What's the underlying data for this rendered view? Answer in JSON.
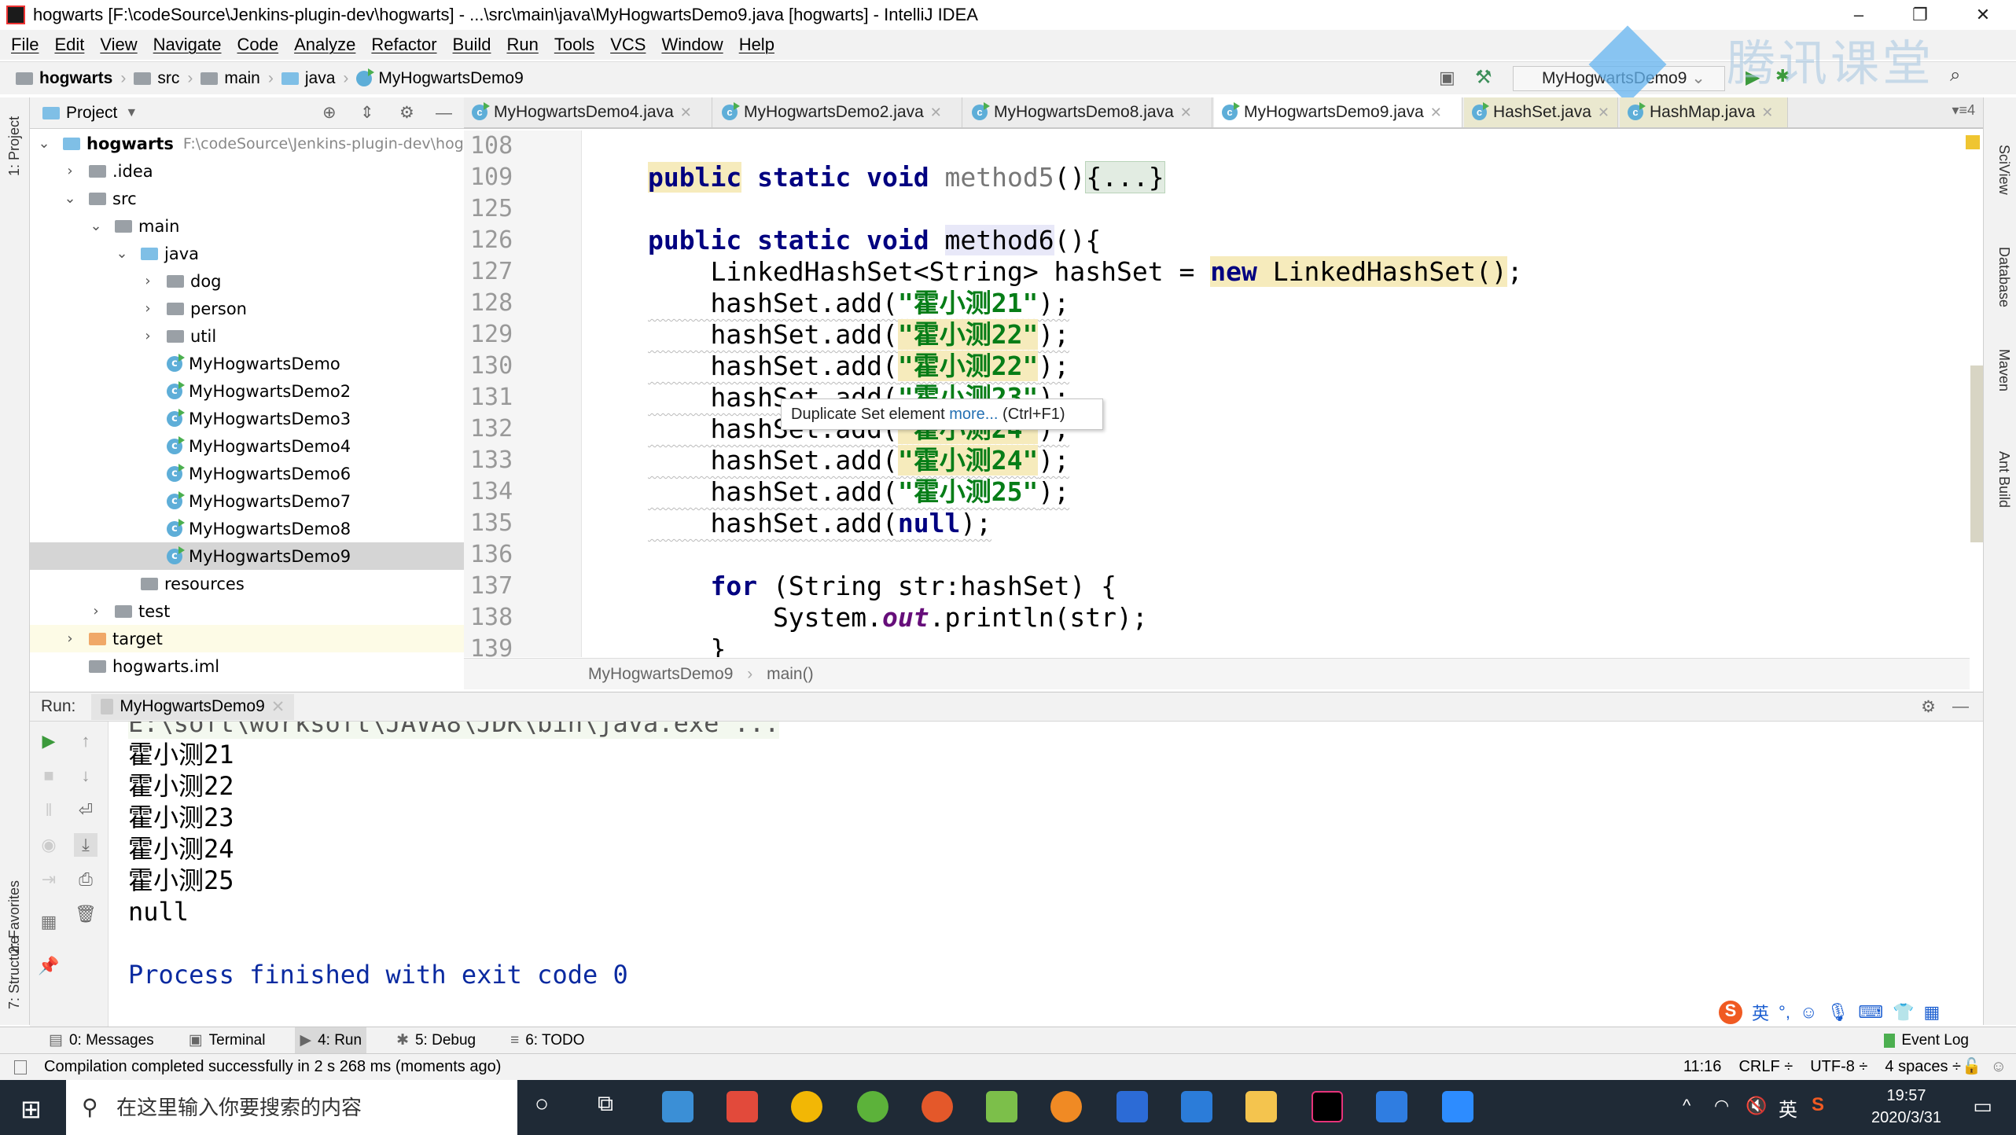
{
  "window": {
    "title": "hogwarts [F:\\codeSource\\Jenkins-plugin-dev\\hogwarts] - ...\\src\\main\\java\\MyHogwartsDemo9.java [hogwarts] - IntelliJ IDEA",
    "minimize": "–",
    "maximize": "❐",
    "close": "✕"
  },
  "menu": [
    "File",
    "Edit",
    "View",
    "Navigate",
    "Code",
    "Analyze",
    "Refactor",
    "Build",
    "Run",
    "Tools",
    "VCS",
    "Window",
    "Help"
  ],
  "breadcrumb": [
    "hogwarts",
    "src",
    "main",
    "java",
    "MyHogwartsDemo9"
  ],
  "run_config": "MyHogwartsDemo9",
  "watermark": "腾讯课堂",
  "left_stripe": {
    "project": "1: Project",
    "favorites": "2: Favorites",
    "structure": "7: Structure"
  },
  "right_stripe": [
    "SciView",
    "Database",
    "Maven",
    "Ant Build"
  ],
  "project": {
    "header": "Project",
    "tree": [
      {
        "label": "hogwarts",
        "path": "F:\\codeSource\\Jenkins-plugin-dev\\hog",
        "depth": 0,
        "arrow": "⌄",
        "icon": "module-folder",
        "bold": true
      },
      {
        "label": ".idea",
        "depth": 1,
        "arrow": "›",
        "icon": "folder"
      },
      {
        "label": "src",
        "depth": 1,
        "arrow": "⌄",
        "icon": "folder"
      },
      {
        "label": "main",
        "depth": 2,
        "arrow": "⌄",
        "icon": "folder"
      },
      {
        "label": "java",
        "depth": 3,
        "arrow": "⌄",
        "icon": "source-folder"
      },
      {
        "label": "dog",
        "depth": 4,
        "arrow": "›",
        "icon": "package"
      },
      {
        "label": "person",
        "depth": 4,
        "arrow": "›",
        "icon": "package"
      },
      {
        "label": "util",
        "depth": 4,
        "arrow": "›",
        "icon": "package"
      },
      {
        "label": "MyHogwartsDemo",
        "depth": 4,
        "arrow": "",
        "icon": "class"
      },
      {
        "label": "MyHogwartsDemo2",
        "depth": 4,
        "arrow": "",
        "icon": "class"
      },
      {
        "label": "MyHogwartsDemo3",
        "depth": 4,
        "arrow": "",
        "icon": "class"
      },
      {
        "label": "MyHogwartsDemo4",
        "depth": 4,
        "arrow": "",
        "icon": "class"
      },
      {
        "label": "MyHogwartsDemo6",
        "depth": 4,
        "arrow": "",
        "icon": "class"
      },
      {
        "label": "MyHogwartsDemo7",
        "depth": 4,
        "arrow": "",
        "icon": "class"
      },
      {
        "label": "MyHogwartsDemo8",
        "depth": 4,
        "arrow": "",
        "icon": "class"
      },
      {
        "label": "MyHogwartsDemo9",
        "depth": 4,
        "arrow": "",
        "icon": "class",
        "selected": true
      },
      {
        "label": "resources",
        "depth": 3,
        "arrow": "",
        "icon": "resources-folder"
      },
      {
        "label": "test",
        "depth": 2,
        "arrow": "›",
        "icon": "folder"
      },
      {
        "label": "target",
        "depth": 1,
        "arrow": "›",
        "icon": "excluded-folder",
        "target": true
      },
      {
        "label": "hogwarts.iml",
        "depth": 1,
        "arrow": "",
        "icon": "iml-file"
      }
    ]
  },
  "tabs": [
    {
      "label": "MyHogwartsDemo4.java"
    },
    {
      "label": "MyHogwartsDemo2.java"
    },
    {
      "label": "MyHogwartsDemo8.java"
    },
    {
      "label": "MyHogwartsDemo9.java",
      "active": true
    },
    {
      "label": "HashSet.java",
      "lib": true
    },
    {
      "label": "HashMap.java",
      "lib": true
    }
  ],
  "tabs_overflow": "▾≡4",
  "code": [
    {
      "num": "108",
      "tokens": []
    },
    {
      "num": "109",
      "tokens": [
        {
          "t": "public",
          "k": "kw hl"
        },
        {
          "t": " static void ",
          "k": "kw"
        },
        {
          "t": "method5",
          "k": "gray"
        },
        {
          "t": "()",
          "k": ""
        },
        {
          "t": "{...}",
          "k": "fb"
        }
      ]
    },
    {
      "num": "125",
      "tokens": []
    },
    {
      "num": "126",
      "tokens": [
        {
          "t": "public static void ",
          "k": "kw"
        },
        {
          "t": "method6",
          "k": "mhl"
        },
        {
          "t": "(){",
          "k": ""
        }
      ]
    },
    {
      "num": "127",
      "tokens": [
        {
          "t": "    LinkedHashSet<String> hashSet = ",
          "k": ""
        },
        {
          "t": "new",
          "k": "kw hl"
        },
        {
          "t": " LinkedHashSet()",
          "k": "hl"
        },
        {
          "t": ";",
          "k": ""
        }
      ]
    },
    {
      "num": "128",
      "tokens": [
        {
          "t": "    hashSet.add(",
          "k": "squig"
        },
        {
          "t": "\"霍小测21\"",
          "k": "str squig"
        },
        {
          "t": ");",
          "k": "squig"
        }
      ]
    },
    {
      "num": "129",
      "tokens": [
        {
          "t": "    hashSet.add(",
          "k": "squig"
        },
        {
          "t": "\"霍小测22\"",
          "k": "str hl squig"
        },
        {
          "t": ");",
          "k": "squig"
        }
      ]
    },
    {
      "num": "130",
      "tokens": [
        {
          "t": "    hashSet.add(",
          "k": "squig"
        },
        {
          "t": "\"霍小测22\"",
          "k": "str hl squig"
        },
        {
          "t": ");",
          "k": "squig"
        }
      ]
    },
    {
      "num": "131",
      "tokens": [
        {
          "t": "    hashSet.add(",
          "k": "squig"
        },
        {
          "t": "\"霍小测23\"",
          "k": "str squig"
        },
        {
          "t": ");",
          "k": "squig"
        }
      ]
    },
    {
      "num": "132",
      "tokens": [
        {
          "t": "    hashSet.add(",
          "k": "squig"
        },
        {
          "t": "\"霍小测24\"",
          "k": "str hl squig"
        },
        {
          "t": ");",
          "k": "squig"
        }
      ]
    },
    {
      "num": "133",
      "tokens": [
        {
          "t": "    hashSet.add(",
          "k": "squig"
        },
        {
          "t": "\"霍小测24\"",
          "k": "str hl squig"
        },
        {
          "t": ");",
          "k": "squig"
        }
      ]
    },
    {
      "num": "134",
      "tokens": [
        {
          "t": "    hashSet.add(",
          "k": "squig"
        },
        {
          "t": "\"霍小测25\"",
          "k": "str squig"
        },
        {
          "t": ");",
          "k": "squig"
        }
      ]
    },
    {
      "num": "135",
      "tokens": [
        {
          "t": "    hashSet.add(",
          "k": "squig"
        },
        {
          "t": "null",
          "k": "kw squig"
        },
        {
          "t": ");",
          "k": "squig"
        }
      ]
    },
    {
      "num": "136",
      "tokens": []
    },
    {
      "num": "137",
      "tokens": [
        {
          "t": "    ",
          "k": ""
        },
        {
          "t": "for",
          "k": "kw"
        },
        {
          "t": " (String str:hashSet) {",
          "k": ""
        }
      ]
    },
    {
      "num": "138",
      "tokens": [
        {
          "t": "        System.",
          "k": ""
        },
        {
          "t": "out",
          "k": "fld"
        },
        {
          "t": ".println(str);",
          "k": ""
        }
      ]
    },
    {
      "num": "139",
      "tokens": [
        {
          "t": "    }",
          "k": ""
        }
      ]
    }
  ],
  "tooltip": {
    "text": "Duplicate Set element ",
    "link": "more...",
    "shortcut": " (Ctrl+F1)"
  },
  "editor_breadcrumb": {
    "class": "MyHogwartsDemo9",
    "sep": "›",
    "method": "main()"
  },
  "run": {
    "label": "Run:",
    "tab": "MyHogwartsDemo9",
    "output": [
      "E:\\soft\\worksoft\\JAVA8\\JDK\\bin\\java.exe ...",
      "霍小测21",
      "霍小测22",
      "霍小测23",
      "霍小测24",
      "霍小测25",
      "null",
      "",
      "Process finished with exit code 0"
    ]
  },
  "bottom_tabs": [
    {
      "label": "0: Messages"
    },
    {
      "label": "Terminal"
    },
    {
      "label": "4: Run",
      "active": true
    },
    {
      "label": "5: Debug"
    },
    {
      "label": "6: TODO"
    }
  ],
  "event_log": "Event Log",
  "status": {
    "message": "Compilation completed successfully in 2 s 268 ms (moments ago)",
    "position": "11:16",
    "line_sep": "CRLF ÷",
    "encoding": "UTF-8 ÷",
    "indent": "4 spaces ÷"
  },
  "ime": {
    "lang": "英"
  },
  "taskbar": {
    "search_placeholder": "在这里输入你要搜索的内容",
    "time": "19:57",
    "date": "2020/3/31",
    "ime": "英"
  },
  "colors": {
    "keyword": "#000080",
    "string": "#067d17",
    "highlight": "#f6ebbc",
    "taskbar": "#1f2a36"
  }
}
